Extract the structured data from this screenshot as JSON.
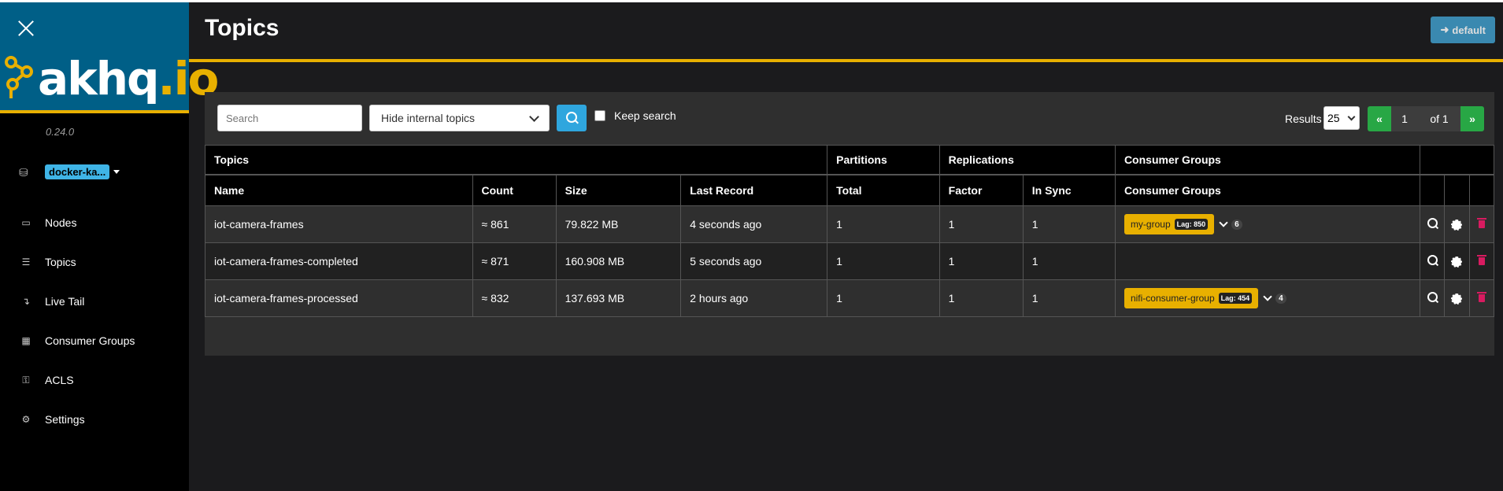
{
  "sidebar": {
    "version": "0.24.0",
    "cluster": "docker-ka...",
    "logo": {
      "text_main": "akhq",
      "text_dot": ".io"
    },
    "items": [
      {
        "label": "Nodes",
        "icon": "laptop-icon"
      },
      {
        "label": "Topics",
        "icon": "list-icon"
      },
      {
        "label": "Live Tail",
        "icon": "level-down-icon"
      },
      {
        "label": "Consumer Groups",
        "icon": "object-group-icon"
      },
      {
        "label": "ACLS",
        "icon": "key-icon"
      },
      {
        "label": "Settings",
        "icon": "gear-icon"
      }
    ]
  },
  "header": {
    "title": "Topics",
    "user_label": "default"
  },
  "toolbar": {
    "search_placeholder": "Search",
    "filter_value": "Hide internal topics",
    "keep_search_label": "Keep search",
    "results_label": "Results",
    "results_per_page": "25",
    "pager": {
      "prev": "«",
      "page": "1",
      "of": "of 1",
      "next": "»"
    }
  },
  "table": {
    "group_headers": {
      "topics": "Topics",
      "partitions": "Partitions",
      "replications": "Replications",
      "consumer_groups": "Consumer Groups"
    },
    "columns": {
      "name": "Name",
      "count": "Count",
      "size": "Size",
      "last_record": "Last Record",
      "total": "Total",
      "factor": "Factor",
      "in_sync": "In Sync",
      "consumer_groups": "Consumer Groups"
    },
    "rows": [
      {
        "name": "iot-camera-frames",
        "count": "≈ 861",
        "size": "79.822 MB",
        "last_record": "4 seconds ago",
        "total": "1",
        "factor": "1",
        "in_sync": "1",
        "group": "my-group",
        "lag": "Lag: 850",
        "more": "6"
      },
      {
        "name": "iot-camera-frames-completed",
        "count": "≈ 871",
        "size": "160.908 MB",
        "last_record": "5 seconds ago",
        "total": "1",
        "factor": "1",
        "in_sync": "1",
        "group": "",
        "lag": "",
        "more": ""
      },
      {
        "name": "iot-camera-frames-processed",
        "count": "≈ 832",
        "size": "137.693 MB",
        "last_record": "2 hours ago",
        "total": "1",
        "factor": "1",
        "in_sync": "1",
        "group": "nifi-consumer-group",
        "lag": "Lag: 454",
        "more": "4"
      }
    ]
  },
  "colors": {
    "brand_blue": "#005f87",
    "accent_yellow": "#e8b000",
    "badge_blue": "#3fb4e6",
    "pager_green": "#28a745",
    "delete_pink": "#d81b60"
  }
}
